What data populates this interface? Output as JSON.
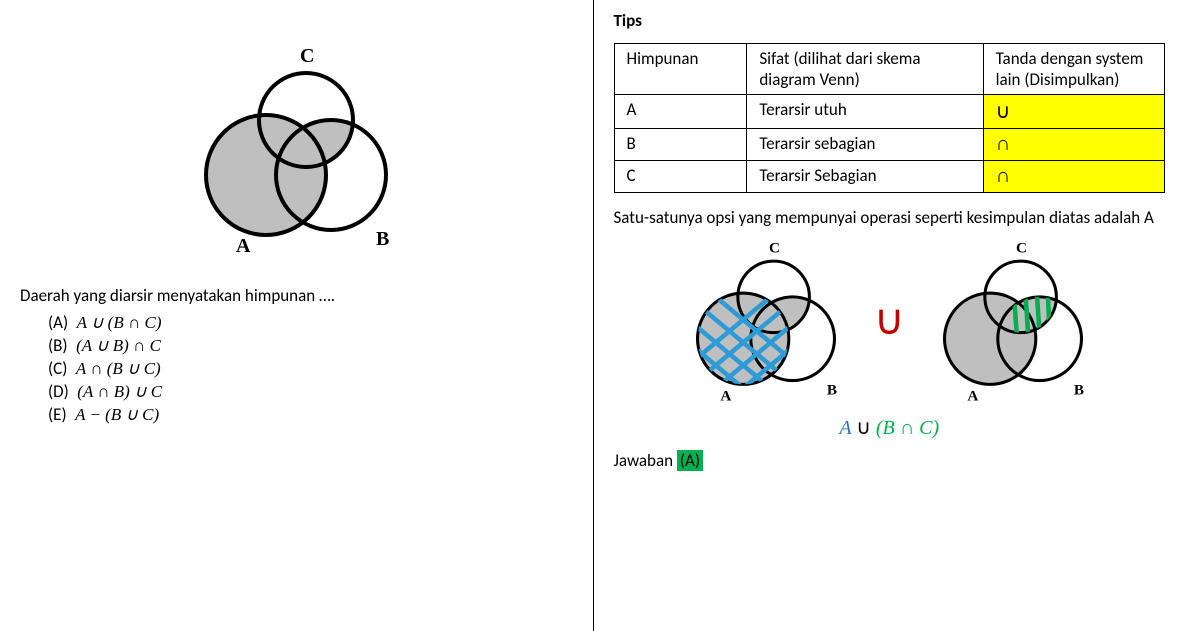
{
  "question": {
    "text": "Daerah yang diarsir menyatakan himpunan ….",
    "venn_labels": {
      "A": "A",
      "B": "B",
      "C": "C"
    },
    "options": [
      {
        "label": "(A)",
        "expr": "A ∪ (B ∩ C)"
      },
      {
        "label": "(B)",
        "expr": "(A ∪ B) ∩ C"
      },
      {
        "label": "(C)",
        "expr": "A ∩ (B ∪ C)"
      },
      {
        "label": "(D)",
        "expr": "(A ∩ B) ∪ C"
      },
      {
        "label": "(E)",
        "expr": "A − (B ∪ C)"
      }
    ]
  },
  "tips": {
    "title": "Tips",
    "headers": {
      "col1": "Himpunan",
      "col2": "Sifat (dilihat dari skema diagram Venn)",
      "col3": "Tanda dengan system lain (Disimpulkan)"
    },
    "rows": [
      {
        "set": "A",
        "sifat": "Terarsir utuh",
        "tanda": "∪"
      },
      {
        "set": "B",
        "sifat": "Terarsir sebagian",
        "tanda": "∩"
      },
      {
        "set": "C",
        "sifat": "Terarsir Sebagian",
        "tanda": "∩"
      }
    ],
    "conclusion_text": "Satu-satunya opsi yang mempunyai operasi seperti kesimpulan diatas adalah A",
    "union_symbol": "∪",
    "expr_parts": {
      "left": "A",
      "union": "∪",
      "right": "(B ∩ C)"
    },
    "answer_label": "Jawaban",
    "answer_value": "(A)"
  },
  "chart_data": [
    {
      "type": "venn3",
      "title": "Question Venn",
      "sets": [
        "A",
        "B",
        "C"
      ],
      "shaded_regions": [
        "A_only",
        "A∩B_only",
        "A∩C_only",
        "A∩B∩C",
        "B∩C_only"
      ],
      "description": "Shaded region = A ∪ (B ∩ C)"
    },
    {
      "type": "venn3",
      "title": "Conclusion left (blue cross-hatch)",
      "sets": [
        "A",
        "B",
        "C"
      ],
      "highlighted_regions": [
        "A (full circle)"
      ],
      "highlight_color": "#2e74b5",
      "description": "Set A fully hatched in blue"
    },
    {
      "type": "venn3",
      "title": "Conclusion right (green hatch)",
      "sets": [
        "A",
        "B",
        "C"
      ],
      "highlighted_regions": [
        "B ∩ C"
      ],
      "highlight_color": "#00b050",
      "description": "B ∩ C hatched in green"
    }
  ]
}
